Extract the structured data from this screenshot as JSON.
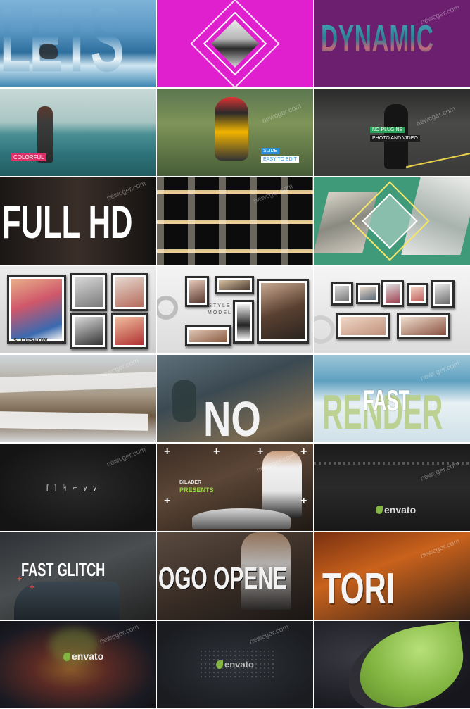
{
  "watermark": "newcger.com",
  "tiles": {
    "lets": "LETS",
    "dynamic": "DYNAMIC",
    "colorful": "COLORFUL",
    "slide": "SLIDE",
    "easy_to_edit": "EASY TO EDIT",
    "no_plugins": "NO PLUGINS",
    "photo_and_video": "PHOTO AND VIDEO",
    "full_hd": "FULL HD",
    "slideshow": "SLIDESHOW",
    "style_model_line1": "STYLE",
    "style_model_line2": "MODEL",
    "no": "NO",
    "render": "RENDER",
    "fast": "FAST",
    "glitch_text": "[ ] ᛋ ⌐ y y",
    "bilader": "BILADER",
    "presents": "PRESENTS",
    "envato": "envato",
    "fast_glitch": "FAST GLITCH",
    "logo_opene": "OGO OPENE",
    "tori": "TORI",
    "plus_sign": "+"
  },
  "colors": {
    "yellow": "#e3d92a",
    "magenta": "#e020cf",
    "purple": "#6b1f6e",
    "teal": "#3f9a7a",
    "envato_green": "#82b541",
    "label_pink": "#e0306a",
    "label_green": "#2aa05a",
    "label_blue": "#2c8fd8"
  }
}
